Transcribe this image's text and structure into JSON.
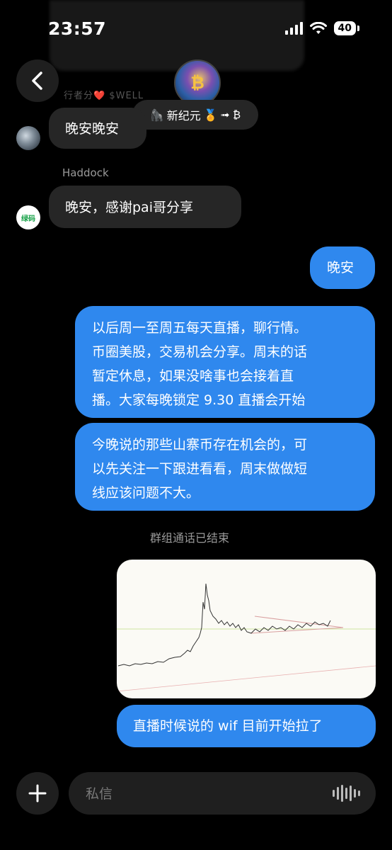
{
  "status_bar": {
    "time": "23:57",
    "battery": "40"
  },
  "background": {
    "blurred_sender": "行者分❤️ $WELL"
  },
  "header": {
    "group_name": "新纪元",
    "avatar_glyph": "₿",
    "chip_suffix": "➟ ₿",
    "back_icon": "chevron-left-icon"
  },
  "messages": {
    "m1": {
      "text": "晚安晚安"
    },
    "m2": {
      "sender": "Haddock",
      "avatar_text": "绿码",
      "text": "晚安，感谢pai哥分享"
    },
    "m3": {
      "text": "晚安"
    },
    "m4": {
      "lines": [
        "以后周一至周五每天直播，聊行情。",
        "币圈美股，交易机会分享。周末的话",
        "暂定休息，如果没啥事也会接着直",
        "播。大家每晚锁定 9.30 直播会开始"
      ]
    },
    "m5": {
      "lines": [
        "今晚说的那些山寨币存在机会的，可",
        "以先关注一下跟进看看，周末做做短",
        "线应该问题不大。"
      ]
    },
    "system": {
      "text": "群组通话已结束"
    },
    "m7": {
      "text": "直播时候说的 wif 目前开始拉了"
    }
  },
  "composer": {
    "placeholder": "私信"
  },
  "colors": {
    "outgoing_bubble": "#2f88ee",
    "incoming_bubble": "#262626",
    "background": "#000000"
  }
}
